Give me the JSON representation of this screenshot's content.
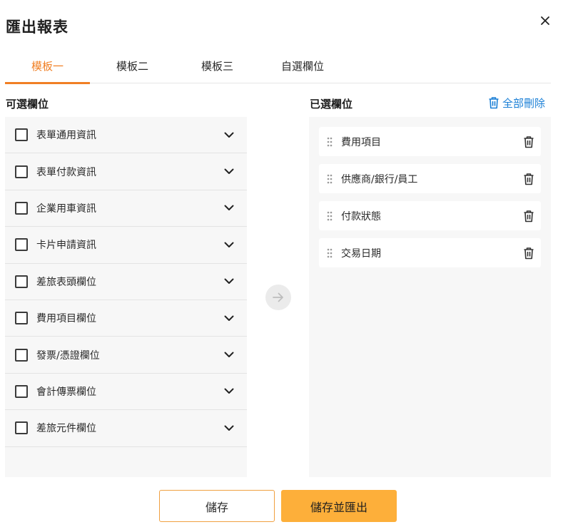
{
  "dialog": {
    "title": "匯出報表"
  },
  "tabs": [
    {
      "label": "模板一",
      "active": true
    },
    {
      "label": "模板二",
      "active": false
    },
    {
      "label": "模板三",
      "active": false
    },
    {
      "label": "自選欄位",
      "active": false
    }
  ],
  "available": {
    "title": "可選欄位",
    "items": [
      {
        "label": "表單通用資訊",
        "checked": false
      },
      {
        "label": "表單付款資訊",
        "checked": false
      },
      {
        "label": "企業用車資訊",
        "checked": false
      },
      {
        "label": "卡片申請資訊",
        "checked": false
      },
      {
        "label": "差旅表頭欄位",
        "checked": false
      },
      {
        "label": "費用項目欄位",
        "checked": false
      },
      {
        "label": "發票/憑證欄位",
        "checked": false
      },
      {
        "label": "會計傳票欄位",
        "checked": false
      },
      {
        "label": "差旅元件欄位",
        "checked": false
      }
    ]
  },
  "selected": {
    "title": "已選欄位",
    "delete_all_label": "全部刪除",
    "items": [
      {
        "label": "費用項目"
      },
      {
        "label": "供應商/銀行/員工"
      },
      {
        "label": "付款狀態"
      },
      {
        "label": "交易日期"
      }
    ]
  },
  "footer": {
    "save_label": "儲存",
    "save_export_label": "儲存並匯出"
  },
  "colors": {
    "accent": "#f07f24",
    "link": "#1a7fd6",
    "primary_button": "#fdaf3a"
  },
  "icons": {
    "close": "close-icon",
    "chevron": "chevron-down-icon",
    "arrow": "arrow-right-icon",
    "drag": "drag-handle-icon",
    "trash": "trash-icon"
  }
}
